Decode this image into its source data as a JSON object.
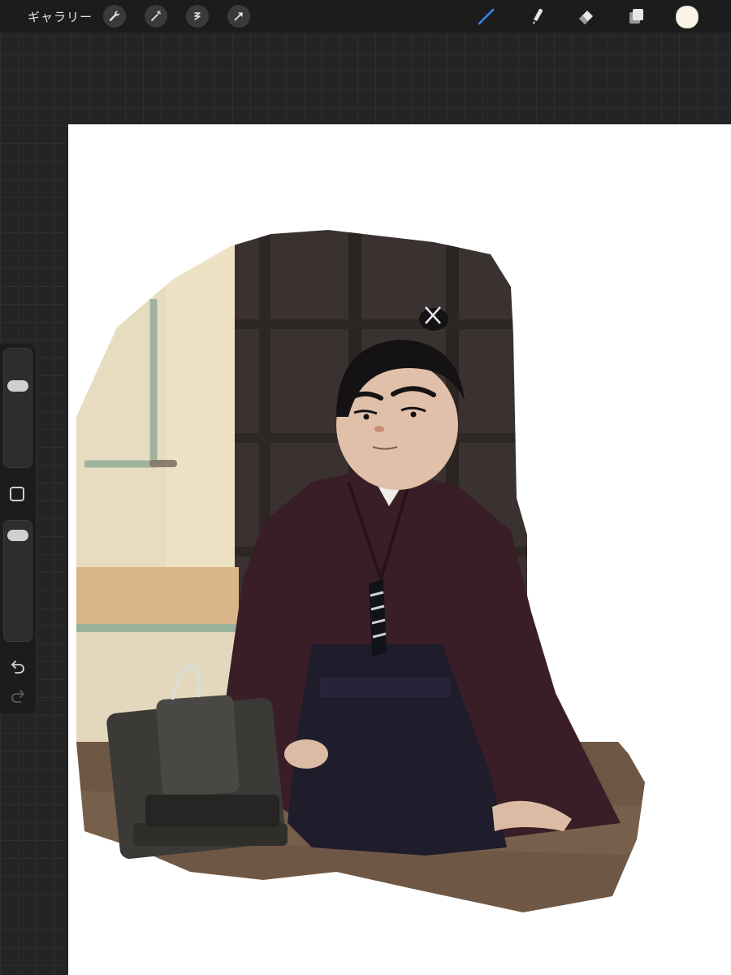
{
  "toolbar": {
    "gallery_label": "ギャラリー",
    "actions": [
      "wrench-icon",
      "magic-wand-icon",
      "selection-icon",
      "transform-arrow-icon"
    ],
    "tools": [
      "brush-icon",
      "smudge-icon",
      "eraser-icon",
      "layers-icon"
    ],
    "active_tool": "brush-icon",
    "current_color": "#fcf4e8",
    "accent_color": "#3b82f6"
  },
  "sidebar": {
    "brush_size_level": 0.28,
    "opacity_level": 0.05,
    "controls": [
      "modify-button",
      "undo-icon",
      "redo-icon"
    ]
  },
  "canvas": {
    "background": "#ffffff",
    "artwork_palette": {
      "wall": "#ede2c3",
      "wood_dark": "#3a3230",
      "floor": "#6e5845",
      "kimono": "#3a1e27",
      "hakama": "#1f1c2c",
      "hair": "#141214",
      "skin": "#e0c0a8"
    }
  }
}
